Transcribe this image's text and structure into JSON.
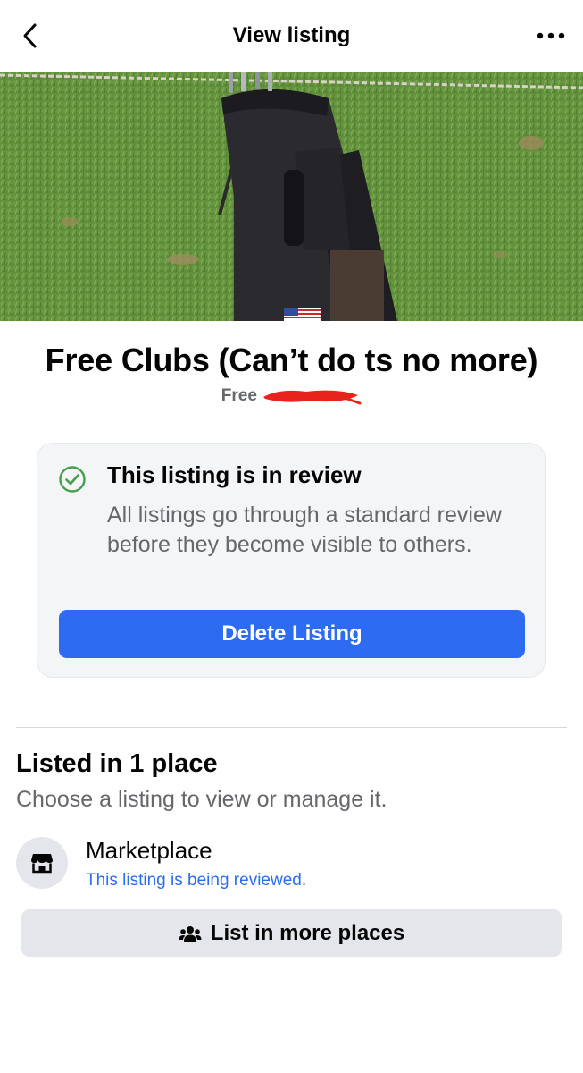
{
  "header": {
    "title": "View listing",
    "back_icon": "chevron-left-icon",
    "more_icon": "more-dots-icon"
  },
  "listing": {
    "title": "Free Clubs (Can’t do ts no more)",
    "price": "Free"
  },
  "review_notice": {
    "heading": "This listing is in review",
    "body": "All listings go through a standard review before they become visible to others.",
    "delete_label": "Delete Listing",
    "status_color": "#42a04b"
  },
  "places": {
    "title": "Listed in 1 place",
    "subtitle": "Choose a listing to view or manage it.",
    "items": [
      {
        "name": "Marketplace",
        "status": "This listing is being reviewed.",
        "icon": "storefront-icon"
      }
    ],
    "list_more_label": "List in more places",
    "list_more_icon": "people-group-icon"
  },
  "colors": {
    "accent": "#2d6cf0",
    "secondary_text": "#65676b",
    "card_bg": "#f4f5f7",
    "redaction": "#e8231b"
  }
}
